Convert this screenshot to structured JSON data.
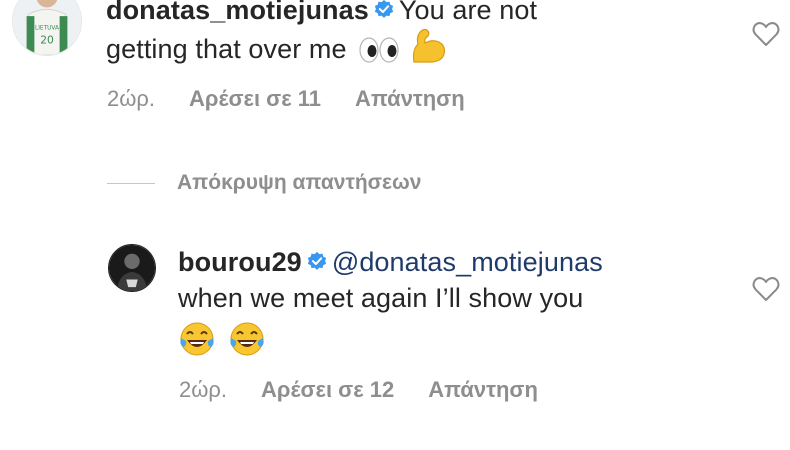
{
  "comments": [
    {
      "username": "donatas_motiejunas",
      "text_line1": "You are not",
      "text_line2": "getting that over me",
      "emojis": [
        "eyes",
        "flexed-biceps"
      ],
      "avatar_jersey_text": "LIETUVA",
      "avatar_jersey_number": "20",
      "time": "2ώρ.",
      "likes": "Αρέσει σε 11",
      "reply": "Απάντηση"
    },
    {
      "username": "bourou29",
      "mention": "@donatas_motiejunas",
      "text_line2": "when we meet again I’ll show you",
      "emojis": [
        "tears-of-joy",
        "tears-of-joy"
      ],
      "time": "2ώρ.",
      "likes": "Αρέσει σε 12",
      "reply": "Απάντηση"
    }
  ],
  "hide_replies": "Απόκρυψη απαντήσεων",
  "colors": {
    "text": "#262626",
    "meta": "#8e8e8e",
    "verified": "#3897f0",
    "mention": "#1f3b6b"
  }
}
